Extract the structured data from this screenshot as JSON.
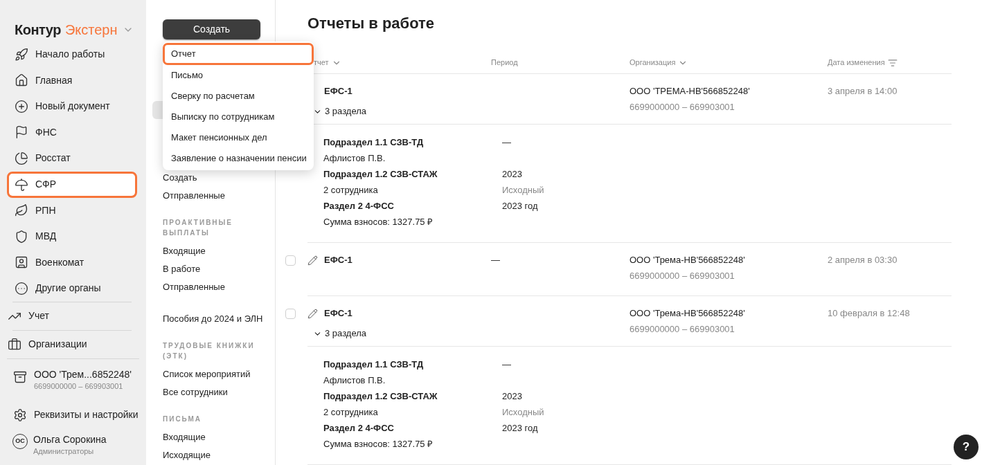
{
  "logo": {
    "brand": "Контур",
    "product": "Экстерн"
  },
  "nav": [
    {
      "label": "Начало работы",
      "selected": false
    },
    {
      "label": "Главная",
      "selected": false
    },
    {
      "label": "Новый документ",
      "selected": false
    },
    {
      "label": "ФНС",
      "selected": false
    },
    {
      "label": "Росстат",
      "selected": false
    },
    {
      "label": "СФР",
      "selected": true
    },
    {
      "label": "РПН",
      "selected": false
    },
    {
      "label": "МВД",
      "selected": false
    },
    {
      "label": "Военкомат",
      "selected": false
    },
    {
      "label": "Другие органы",
      "selected": false
    }
  ],
  "nav_secondary": [
    {
      "label": "Учет"
    },
    {
      "label": "Организации"
    }
  ],
  "organization": {
    "name": "ООО 'Трем...6852248'",
    "codes": "6699000000 – 669903001"
  },
  "settings": {
    "label": "Реквизиты и настройки"
  },
  "user": {
    "initials": "ОС",
    "name": "Ольга Сорокина",
    "role": "Администраторы"
  },
  "create_button": {
    "label": "Создать"
  },
  "create_menu": [
    {
      "label": "Отчет",
      "selected": true
    },
    {
      "label": "Письмо",
      "selected": false
    },
    {
      "label": "Сверку по расчетам",
      "selected": false
    },
    {
      "label": "Выписку по сотрудникам",
      "selected": false
    },
    {
      "label": "Макет пенсионных дел",
      "selected": false
    },
    {
      "label": "Заявление о назначении пенсии",
      "selected": false
    }
  ],
  "sub_nav": [
    {
      "items": [
        "Создать",
        "Отправленные"
      ]
    },
    {
      "heading": "ПРОАКТИВНЫЕ ВЫПЛАТЫ",
      "items": [
        "Входящие",
        "В работе",
        "Отправленные"
      ]
    },
    {
      "items": [
        "Пособия до 2024 и ЭЛН"
      ]
    },
    {
      "heading": "ТРУДОВЫЕ КНИЖКИ (ЭТК)",
      "items": [
        "Список мероприятий",
        "Все сотрудники"
      ]
    },
    {
      "heading": "ПИСЬМА",
      "items": [
        "Входящие",
        "Исходящие"
      ]
    }
  ],
  "page_title": "Отчеты в работе",
  "table": {
    "columns": [
      {
        "label": "тчет",
        "kind": "dropdown"
      },
      {
        "label": "Период",
        "kind": "plain"
      },
      {
        "label": "Организация",
        "kind": "dropdown"
      },
      {
        "label": "Дата изменения",
        "kind": "order"
      }
    ],
    "rows": [
      {
        "name": "ЕФС-1",
        "org": "ООО 'ТРЕМА-НВ'566852248'",
        "codes": "6699000000 – 669903001",
        "date": "3 апреля в 14:00",
        "sections_label": "3 раздела",
        "expanded": true,
        "sections": [
          {
            "title": "Подраздел 1.1 СЗВ-ТД",
            "subtitle": "Афлистов П.В.",
            "period": "—"
          },
          {
            "title": "Подраздел 1.2 СЗВ-СТАЖ",
            "subtitle": "2 сотрудника",
            "period": "2023",
            "period_note": "Исходный"
          },
          {
            "title": "Раздел 2 4-ФСС",
            "subtitle": "Сумма взносов: 1327.75 ₽",
            "period": "2023 год"
          }
        ]
      },
      {
        "checked": false,
        "name": "ЕФС-1",
        "period": "—",
        "org": "ООО 'Трема-НВ'566852248'",
        "codes": "6699000000 – 669903001",
        "date": "2 апреля в 03:30"
      },
      {
        "checked": false,
        "name": "ЕФС-1",
        "org": "ООО 'Трема-НВ'566852248'",
        "codes": "6699000000 – 669903001",
        "date": "10 февраля в 12:48",
        "sections_label": "3 раздела",
        "expanded": true,
        "sections": [
          {
            "title": "Подраздел 1.1 СЗВ-ТД",
            "subtitle": "Афлистов П.В.",
            "period": "—"
          },
          {
            "title": "Подраздел 1.2 СЗВ-СТАЖ",
            "subtitle": "2 сотрудника",
            "period": "2023",
            "period_note": "Исходный"
          },
          {
            "title": "Раздел 2 4-ФСС",
            "subtitle": "Сумма взносов: 1327.75 ₽",
            "period": "2023 год"
          }
        ]
      }
    ]
  },
  "help_button": {
    "label": "?"
  }
}
